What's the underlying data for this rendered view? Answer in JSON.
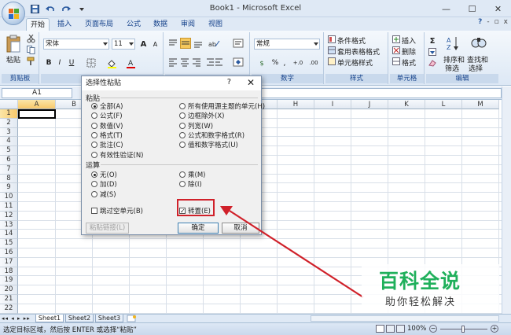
{
  "window": {
    "title": "Book1 - Microsoft Excel",
    "minimize": "—",
    "maximize": "☐",
    "close": "✕"
  },
  "tabs": [
    "开始",
    "插入",
    "页面布局",
    "公式",
    "数据",
    "审阅",
    "视图"
  ],
  "help_icons": {
    "help": "?",
    "min": "-",
    "restore": "▫",
    "close": "x"
  },
  "ribbon": {
    "paste_label": "粘贴",
    "clipboard_label": "剪贴板",
    "font_name": "宋体",
    "font_size": "11",
    "grow": "A",
    "shrink": "A",
    "bold": "B",
    "italic": "I",
    "underline": "U",
    "number_format": "常规",
    "number_label": "数字",
    "percent": "%",
    "comma": ",",
    "increase_dec": "+.0",
    "decrease_dec": ".00",
    "currency": "$",
    "conditional_format": "条件格式",
    "format_as_table": "套用表格格式",
    "cell_styles": "单元格样式",
    "styles_label": "样式",
    "insert": "插入",
    "delete": "删除",
    "format": "格式",
    "cells_label": "单元格",
    "sigma": "Σ",
    "sort_filter": "排序和",
    "sort_filter2": "筛选",
    "find_select": "查找和",
    "find_select2": "选择",
    "editing_label": "编辑"
  },
  "formula_bar": {
    "name_box": "A1"
  },
  "columns": [
    "A",
    "B",
    "C",
    "D",
    "E",
    "F",
    "G",
    "H",
    "I",
    "J",
    "K",
    "L",
    "M"
  ],
  "rows": [
    "1",
    "2",
    "3",
    "4",
    "5",
    "6",
    "7",
    "8",
    "9",
    "10",
    "11",
    "12",
    "13",
    "14",
    "15",
    "16",
    "17",
    "18",
    "19",
    "20",
    "21",
    "22"
  ],
  "sheets": [
    "Sheet1",
    "Sheet2",
    "Sheet3"
  ],
  "status": {
    "text": "选定目标区域，然后按 ENTER 或选择“粘贴”",
    "zoom": "100%"
  },
  "dialog": {
    "title": "选择性粘贴",
    "help": "?",
    "close": "✕",
    "paste_section": "粘贴",
    "paste_left": [
      "全部(A)",
      "公式(F)",
      "数值(V)",
      "格式(T)",
      "批注(C)",
      "有效性验证(N)"
    ],
    "paste_right": [
      "所有使用源主题的单元(H)",
      "边框除外(X)",
      "列宽(W)",
      "公式和数字格式(R)",
      "值和数字格式(U)"
    ],
    "operation_section": "运算",
    "op_left": [
      "无(O)",
      "加(D)",
      "减(S)"
    ],
    "op_right": [
      "乘(M)",
      "除(I)"
    ],
    "skip_blanks": "跳过空单元(B)",
    "transpose": "转置(E)",
    "paste_link": "粘贴链接(L)",
    "ok": "确定",
    "cancel": "取消"
  },
  "watermark": {
    "big": "百科全说",
    "small": "助你轻松解决"
  },
  "colors": {
    "accent_red": "#d0212a",
    "watermark_green": "#1fb05b"
  }
}
